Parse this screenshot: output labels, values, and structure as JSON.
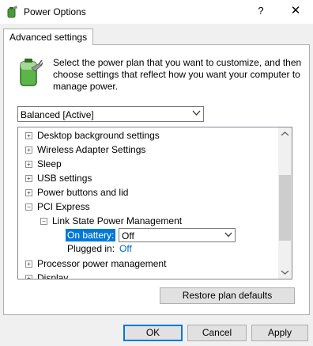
{
  "window": {
    "title": "Power Options",
    "help_glyph": "?",
    "close_glyph": "✕"
  },
  "tab": {
    "label": "Advanced settings"
  },
  "description": "Select the power plan that you want to customize, and then choose settings that reflect how you want your computer to manage power.",
  "plan": {
    "selected": "Balanced [Active]"
  },
  "tree": {
    "items": [
      {
        "label": "Desktop background settings",
        "expander": "+"
      },
      {
        "label": "Wireless Adapter Settings",
        "expander": "+"
      },
      {
        "label": "Sleep",
        "expander": "+"
      },
      {
        "label": "USB settings",
        "expander": "+"
      },
      {
        "label": "Power buttons and lid",
        "expander": "+"
      },
      {
        "label": "PCI Express",
        "expander": "−"
      },
      {
        "label": "Link State Power Management",
        "expander": "−"
      },
      {
        "label": "Processor power management",
        "expander": "+"
      },
      {
        "label": "Display",
        "expander": "+"
      }
    ],
    "on_battery": {
      "label": "On battery:",
      "value": "Off"
    },
    "plugged_in": {
      "label": "Plugged in:",
      "value": "Off"
    }
  },
  "buttons": {
    "restore": "Restore plan defaults",
    "ok": "OK",
    "cancel": "Cancel",
    "apply": "Apply"
  },
  "colors": {
    "accent": "#0078d7",
    "link": "#0066cc",
    "panel_bg": "#ffffff",
    "window_bg": "#f0f0f0"
  },
  "icons": {
    "app": "power-options-icon",
    "plan": "battery-plug-icon",
    "dropdown": "chevron-down-icon",
    "scroll_up": "arrow-up-icon",
    "scroll_down": "arrow-down-icon"
  }
}
